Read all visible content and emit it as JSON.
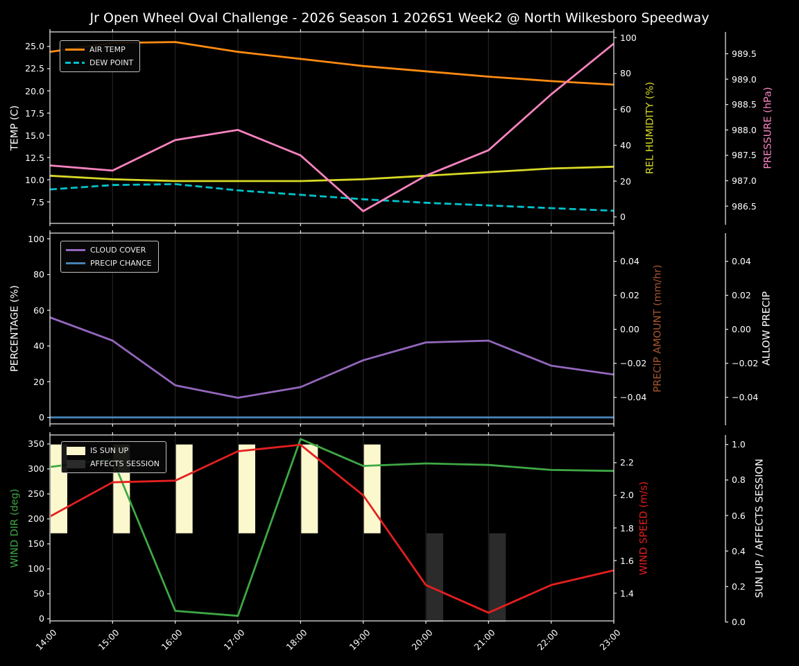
{
  "title": "Jr Open Wheel Oval Challenge - 2026 Season 1 2026S1 Week2 @ North Wilkesboro Speedway",
  "x_labels": [
    "14:00",
    "15:00",
    "16:00",
    "17:00",
    "18:00",
    "19:00",
    "20:00",
    "21:00",
    "22:00",
    "23:00"
  ],
  "chart_data": [
    {
      "type": "line",
      "x": [
        "14:00",
        "15:00",
        "16:00",
        "17:00",
        "18:00",
        "19:00",
        "20:00",
        "21:00",
        "22:00",
        "23:00"
      ],
      "axes": {
        "left": {
          "label": "TEMP (C)",
          "color": "#ffffff",
          "ticks": [
            "7.5",
            "10.0",
            "12.5",
            "15.0",
            "17.5",
            "20.0",
            "22.5",
            "25.0"
          ],
          "tick_values": [
            7.5,
            10,
            12.5,
            15,
            17.5,
            20,
            22.5,
            25
          ],
          "range": [
            5.08,
            26.64
          ]
        },
        "right1": {
          "label": "REL HUMIDITY (%)",
          "color": "#d9d926",
          "ticks": [
            "0",
            "20",
            "40",
            "60",
            "80",
            "100"
          ],
          "tick_values": [
            0,
            20,
            40,
            60,
            80,
            100
          ],
          "range": [
            -3.6,
            103.2
          ]
        },
        "right2": {
          "label": "PRESSURE (hPa)",
          "color": "#f883bf",
          "ticks": [
            "986.5",
            "987.0",
            "987.5",
            "988.0",
            "988.5",
            "989.0",
            "989.5"
          ],
          "tick_values": [
            986.5,
            987,
            987.5,
            988,
            988.5,
            989,
            989.5
          ],
          "range": [
            986.16,
            989.93
          ]
        }
      },
      "series": [
        {
          "name": "AIR TEMP",
          "axis": "left",
          "style": "solid",
          "color": "#ff8b12",
          "values": [
            24.4,
            25.4,
            25.5,
            24.4,
            23.6,
            22.8,
            22.2,
            21.6,
            21.1,
            20.7
          ]
        },
        {
          "name": "DEW POINT",
          "axis": "left",
          "style": "dashed",
          "color": "#00c2cc",
          "values": [
            8.9,
            9.4,
            9.5,
            8.8,
            8.3,
            7.8,
            7.4,
            7.1,
            6.8,
            6.5
          ]
        },
        {
          "name": "REL HUMIDITY",
          "axis": "right1",
          "style": "solid",
          "color": "#d9d926",
          "values": [
            23,
            21,
            20,
            20,
            20,
            21,
            23,
            25,
            27,
            28
          ]
        },
        {
          "name": "PRESSURE",
          "axis": "right2",
          "style": "solid",
          "color": "#f883bf",
          "values": [
            987.3,
            987.2,
            987.8,
            988.0,
            987.5,
            986.4,
            987.1,
            987.6,
            988.7,
            989.7
          ]
        }
      ],
      "legend": [
        "AIR TEMP",
        "DEW POINT"
      ]
    },
    {
      "type": "line",
      "x": [
        "14:00",
        "15:00",
        "16:00",
        "17:00",
        "18:00",
        "19:00",
        "20:00",
        "21:00",
        "22:00",
        "23:00"
      ],
      "axes": {
        "left": {
          "label": "PERCENTAGE (%)",
          "color": "#ffffff",
          "ticks": [
            "0",
            "20",
            "40",
            "60",
            "80",
            "100"
          ],
          "tick_values": [
            0,
            20,
            40,
            60,
            80,
            100
          ],
          "range": [
            -3.6,
            103.2
          ]
        },
        "right1": {
          "label": "PRECIP AMOUNT (mm/hr)",
          "color": "#a8562f",
          "ticks": [
            "−0.04",
            "−0.02",
            "0.00",
            "0.02",
            "0.04"
          ],
          "tick_values": [
            -0.04,
            -0.02,
            0,
            0.02,
            0.04
          ],
          "range": [
            -0.0556,
            0.0566
          ]
        },
        "right2": {
          "label": "ALLOW PRECIP",
          "color": "#ffffff",
          "ticks": [
            "−0.04",
            "−0.02",
            "0.00",
            "0.02",
            "0.04"
          ],
          "tick_values": [
            -0.04,
            -0.02,
            0,
            0.02,
            0.04
          ],
          "range": [
            -0.0556,
            0.0566
          ]
        }
      },
      "series": [
        {
          "name": "CLOUD COVER",
          "axis": "left",
          "style": "solid",
          "color": "#9467bd",
          "values": [
            56,
            43,
            18,
            11,
            17,
            32,
            42,
            43,
            29,
            24
          ]
        },
        {
          "name": "PRECIP CHANCE",
          "axis": "left",
          "style": "solid",
          "color": "#4682b4",
          "values": [
            0,
            0,
            0,
            0,
            0,
            0,
            0,
            0,
            0,
            0
          ]
        }
      ],
      "legend": [
        "CLOUD COVER",
        "PRECIP CHANCE"
      ]
    },
    {
      "type": "line",
      "x": [
        "14:00",
        "15:00",
        "16:00",
        "17:00",
        "18:00",
        "19:00",
        "20:00",
        "21:00",
        "22:00",
        "23:00"
      ],
      "axes": {
        "left": {
          "label": "WIND DIR (deg)",
          "color": "#3fa845",
          "ticks": [
            "0",
            "50",
            "100",
            "150",
            "200",
            "250",
            "300",
            "350"
          ],
          "tick_values": [
            0,
            50,
            100,
            150,
            200,
            250,
            300,
            350
          ],
          "range": [
            -4.2,
            368
          ]
        },
        "right1": {
          "label": "WIND SPEED (m/s)",
          "color": "#e41f1f",
          "ticks": [
            "1.4",
            "1.6",
            "1.8",
            "2.0",
            "2.2"
          ],
          "tick_values": [
            1.4,
            1.6,
            1.8,
            2.0,
            2.2
          ],
          "range": [
            1.23,
            2.37
          ]
        },
        "right2": {
          "label": "SUN UP / AFFECTS SESSION",
          "color": "#ffffff",
          "ticks": [
            "0.0",
            "0.2",
            "0.4",
            "0.6",
            "0.8",
            "1.0"
          ],
          "tick_values": [
            0,
            0.2,
            0.4,
            0.6,
            0.8,
            1.0
          ],
          "range": [
            0.0066,
            1.0535
          ]
        }
      },
      "series": [
        {
          "name": "WIND DIR",
          "axis": "left",
          "style": "solid",
          "color": "#3fa845",
          "values": [
            304,
            320,
            16,
            6,
            360,
            306,
            311,
            308,
            298,
            296
          ]
        },
        {
          "name": "WIND SPEED",
          "axis": "right1",
          "style": "solid",
          "color": "#e41f1f",
          "values": [
            1.87,
            2.08,
            2.09,
            2.27,
            2.31,
            2.0,
            1.45,
            1.28,
            1.45,
            1.54
          ]
        }
      ],
      "bars": [
        {
          "name": "IS SUN UP",
          "axis": "right2",
          "color": "#fbf8cd",
          "from": 0.5,
          "to": 1.0,
          "values": [
            1,
            1,
            1,
            1,
            1,
            1,
            0,
            0,
            0,
            0
          ]
        },
        {
          "name": "AFFECTS SESSION",
          "axis": "right2",
          "color": "#2b2b2b",
          "from": 0.0,
          "to": 0.5,
          "values": [
            0,
            0,
            0,
            0,
            0,
            0,
            1,
            1,
            0,
            0
          ]
        }
      ],
      "legend": [
        "IS SUN UP",
        "AFFECTS SESSION"
      ]
    }
  ]
}
